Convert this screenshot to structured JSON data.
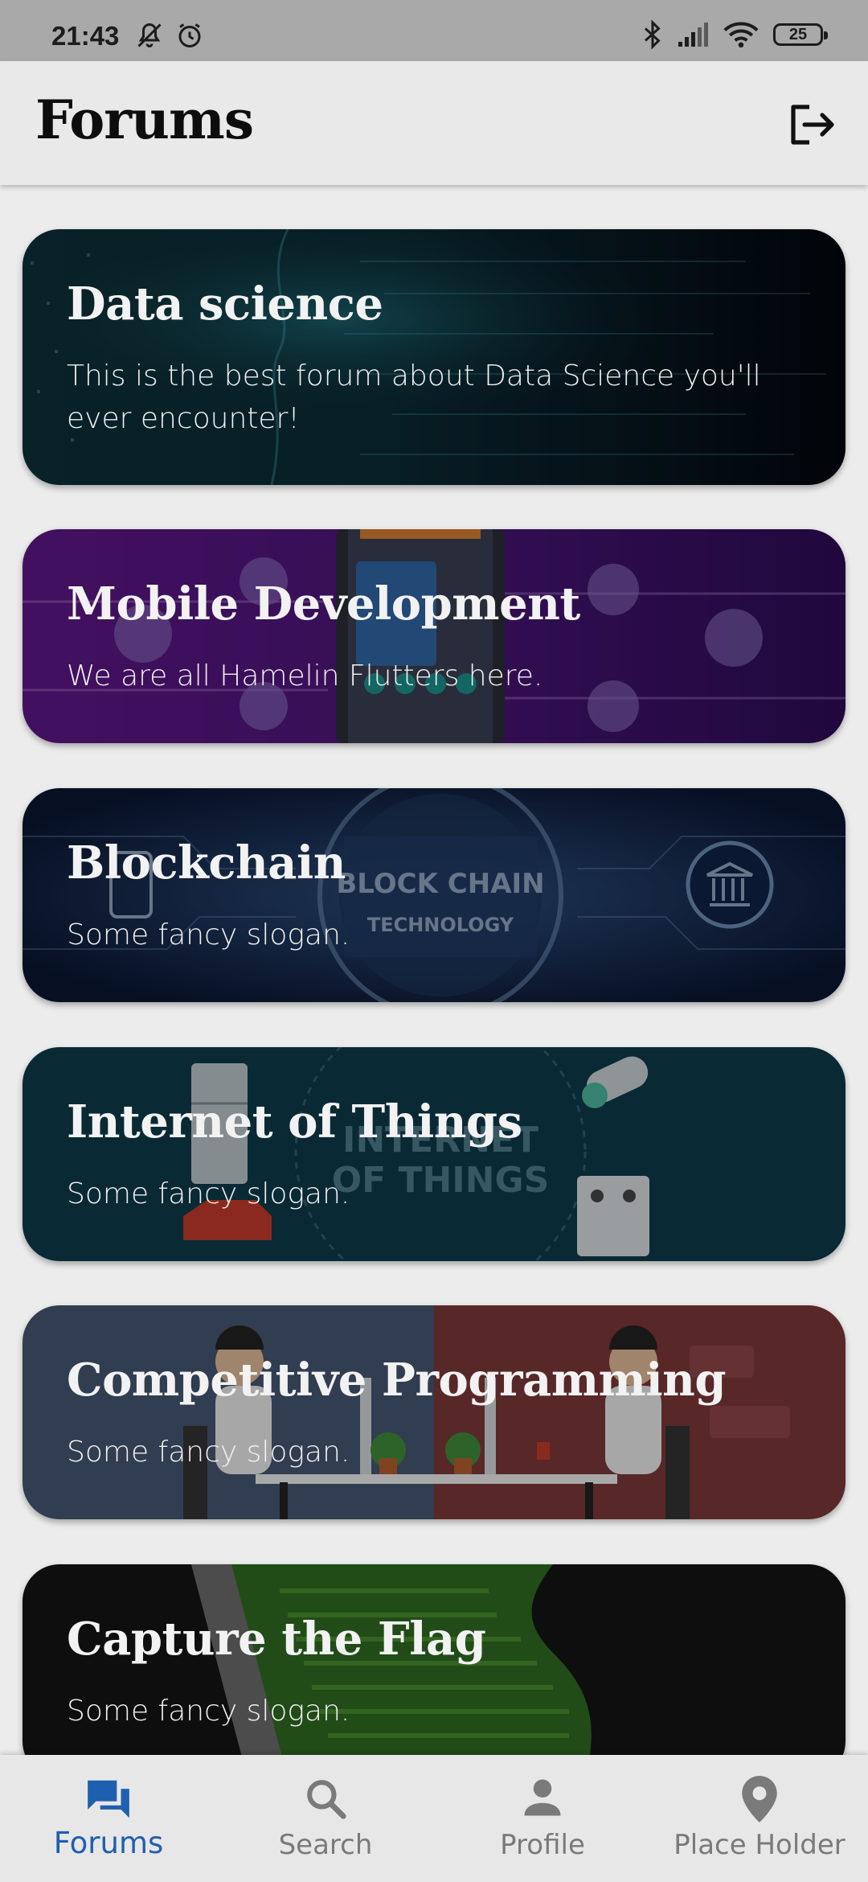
{
  "status_bar": {
    "time": "21:43",
    "battery": "25",
    "icons": [
      "mute-icon",
      "alarm-icon",
      "bluetooth-icon",
      "signal-icon",
      "wifi-icon",
      "battery-icon"
    ]
  },
  "app_bar": {
    "title": "Forums",
    "action_icon": "logout-icon"
  },
  "forums": [
    {
      "title": "Data science",
      "description": "This is the best forum about Data Science you'll ever encounter!"
    },
    {
      "title": "Mobile Development",
      "description": "We are all Hamelin Flutters here."
    },
    {
      "title": "Blockchain",
      "description": "Some fancy slogan.",
      "image_text": [
        "BLOCK CHAIN",
        "TECHNOLOGY"
      ]
    },
    {
      "title": "Internet of Things",
      "description": "Some fancy slogan.",
      "image_text": [
        "INTERNET",
        "OF THINGS"
      ]
    },
    {
      "title": "Competitive Programming",
      "description": "Some fancy slogan."
    },
    {
      "title": "Capture the Flag",
      "description": "Some fancy slogan."
    }
  ],
  "bottom_nav": {
    "active": "Forums",
    "items": [
      {
        "label": "Forums",
        "icon": "forum-icon"
      },
      {
        "label": "Search",
        "icon": "search-icon"
      },
      {
        "label": "Profile",
        "icon": "person-icon"
      },
      {
        "label": "Place Holder",
        "icon": "location-pin-icon"
      }
    ]
  },
  "colors": {
    "active_nav": "#1f5fb0",
    "inactive_nav": "#7a7a7a",
    "app_bar": "#e9e9e9"
  }
}
